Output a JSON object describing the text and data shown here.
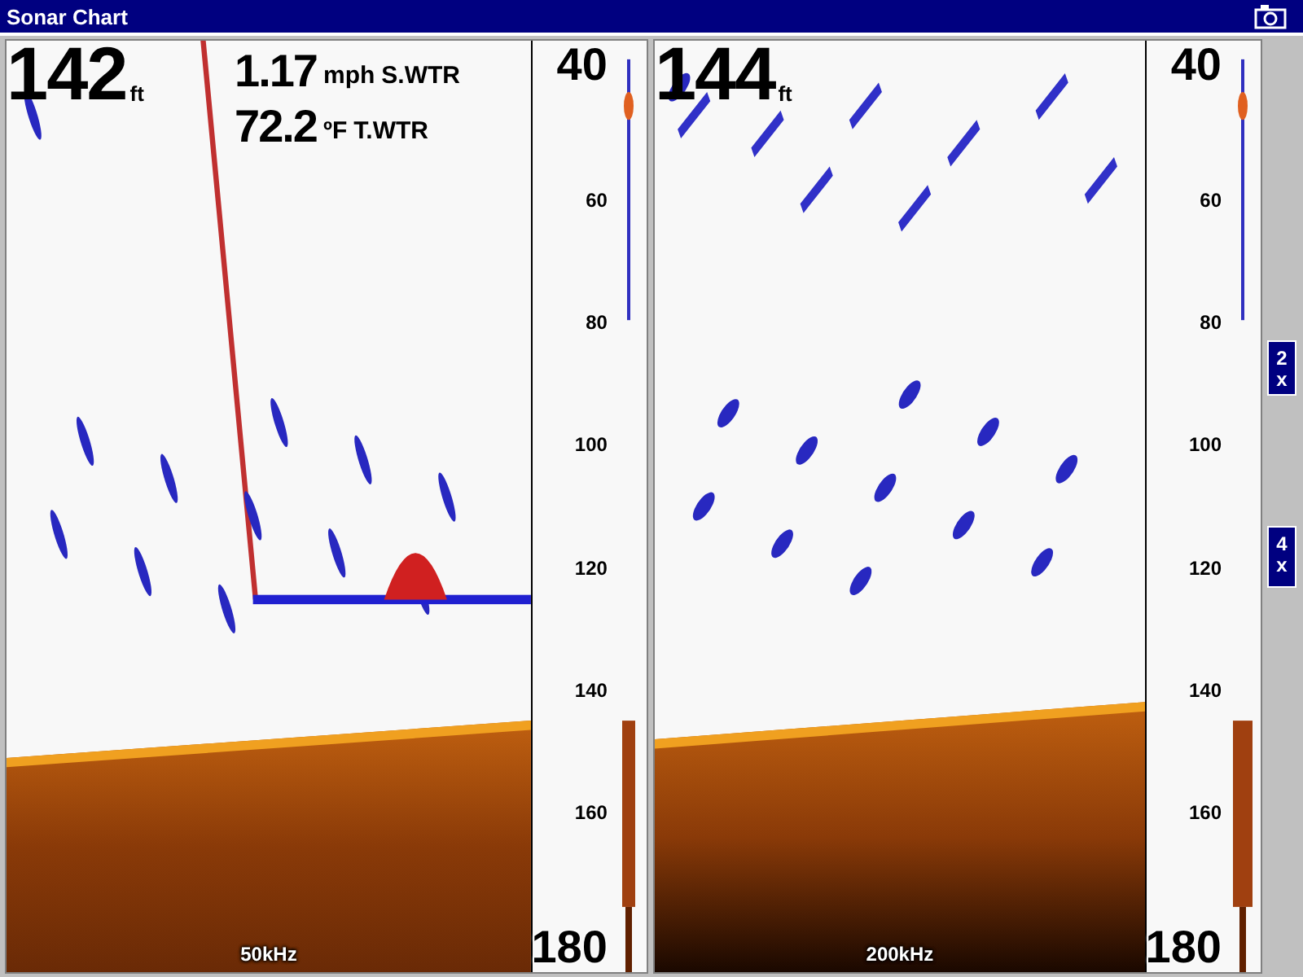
{
  "window": {
    "title": "Sonar Chart"
  },
  "panels": [
    {
      "depth": "142",
      "depth_unit": "ft",
      "readings": [
        {
          "value": "1.17",
          "unit": "mph",
          "label": "S.WTR"
        },
        {
          "value": "72.2",
          "unit": "ºF",
          "label": "T.WTR"
        }
      ],
      "scale": [
        "40",
        "60",
        "80",
        "100",
        "120",
        "140",
        "160",
        "180"
      ],
      "frequency": "50kHz",
      "kind": "low"
    },
    {
      "depth": "144",
      "depth_unit": "ft",
      "scale": [
        "40",
        "60",
        "80",
        "100",
        "120",
        "140",
        "160",
        "180"
      ],
      "frequency": "200kHz",
      "kind": "high"
    }
  ],
  "zoom_buttons": [
    {
      "label": "2x"
    },
    {
      "label": "4x"
    }
  ]
}
